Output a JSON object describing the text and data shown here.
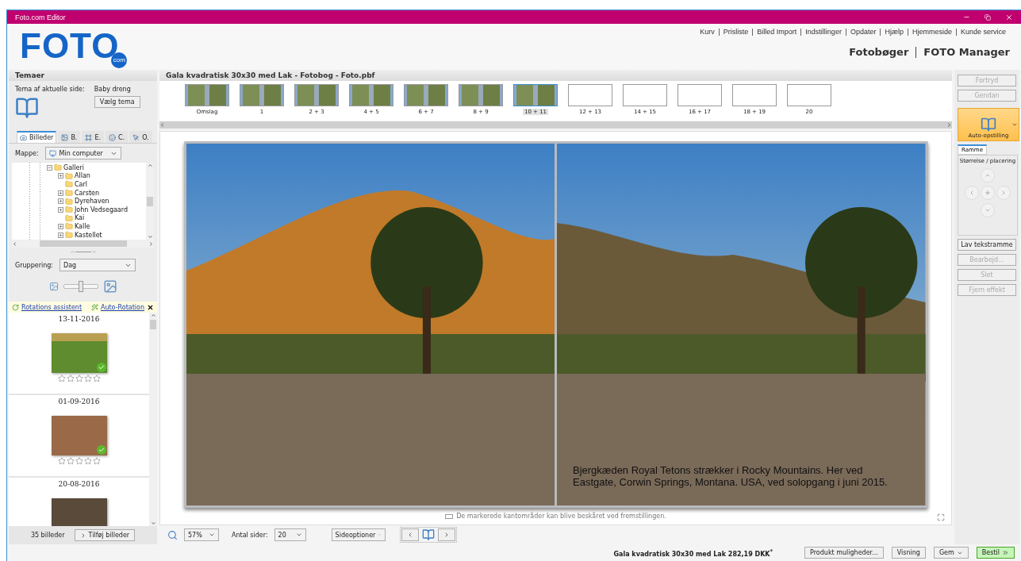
{
  "window": {
    "title": "Foto.com Editor"
  },
  "logo": {
    "text": "FOTO",
    "badge": "com"
  },
  "top_links": [
    "Kurv",
    "Prisliste",
    "Billed Import",
    "Indstillinger",
    "Opdater",
    "Hjælp",
    "Hjemmeside",
    "Kunde service"
  ],
  "header_nav": [
    "Fotobøger",
    "FOTO Manager"
  ],
  "themes": {
    "title": "Temaer",
    "label": "Tema af aktuelle side:",
    "value": "Baby dreng",
    "button": "Vælg tema"
  },
  "source_tabs": [
    {
      "label": "Billeder",
      "selected": true
    },
    {
      "label": "B.",
      "selected": false
    },
    {
      "label": "E.",
      "selected": false
    },
    {
      "label": "C.",
      "selected": false
    },
    {
      "label": "O.",
      "selected": false
    }
  ],
  "folder": {
    "label": "Mappe:",
    "value": "Min computer"
  },
  "tree": [
    {
      "label": "Galleri",
      "kind": "branch",
      "expanded": true,
      "children": [
        {
          "label": "Allan",
          "kind": "branch",
          "expanded": false
        },
        {
          "label": "Carl",
          "kind": "leaf"
        },
        {
          "label": "Carsten",
          "kind": "branch",
          "expanded": false
        },
        {
          "label": "Dyrehaven",
          "kind": "branch",
          "expanded": false
        },
        {
          "label": "John Vedsegaard",
          "kind": "branch",
          "expanded": false
        },
        {
          "label": "Kai",
          "kind": "leaf"
        },
        {
          "label": "Kalle",
          "kind": "branch",
          "expanded": false
        },
        {
          "label": "Kastellet",
          "kind": "branch",
          "expanded": false
        }
      ]
    }
  ],
  "grouping": {
    "label": "Gruppering:",
    "value": "Dag"
  },
  "thumb_size": {
    "level": 0.5
  },
  "rotation": {
    "assistant": "Rotations assistent",
    "auto": "Auto-Rotation"
  },
  "photo_groups": [
    {
      "date": "13-11-2016",
      "photo": {
        "stars": 0,
        "used": true
      }
    },
    {
      "date": "01-09-2016",
      "photo": {
        "stars": 0,
        "used": true
      }
    },
    {
      "date": "20-08-2016"
    }
  ],
  "photo_footer": {
    "count": "35 billeder",
    "button": "Tilføj billeder"
  },
  "document": {
    "title": "Gala kvadratisk 30x30 med Lak - Fotobog - Foto.pbf"
  },
  "pages": [
    {
      "label": "Omslag",
      "kind": "photo",
      "selected": false
    },
    {
      "label": "1",
      "kind": "photo",
      "selected": false
    },
    {
      "label": "2 + 3",
      "kind": "photo",
      "selected": false
    },
    {
      "label": "4 + 5",
      "kind": "photo",
      "selected": false
    },
    {
      "label": "6 + 7",
      "kind": "photo",
      "selected": false
    },
    {
      "label": "8 + 9",
      "kind": "photo",
      "selected": false
    },
    {
      "label": "10 + 11",
      "kind": "photo",
      "selected": true
    },
    {
      "label": "12 + 13",
      "kind": "empty",
      "selected": false
    },
    {
      "label": "14 + 15",
      "kind": "empty",
      "selected": false
    },
    {
      "label": "16 + 17",
      "kind": "empty",
      "selected": false
    },
    {
      "label": "18 + 19",
      "kind": "empty",
      "selected": false
    },
    {
      "label": "20",
      "kind": "empty",
      "selected": false
    }
  ],
  "spread": {
    "caption": "Bjergkæden Royal Tetons strækker i Rocky Mountains. Her ved Eastgate, Corwin Springs, Montana. USA, ved solopgang i juni 2015.",
    "notice": "De markerede kantområder kan blive beskåret ved fremstillingen."
  },
  "toolbar": {
    "zoom": "57%",
    "pages_label": "Antal sider:",
    "pages_value": "20",
    "page_options": "Sideoptioner"
  },
  "side_actions": [
    {
      "label": "Fortryd",
      "disabled": true
    },
    {
      "label": "Gendan",
      "disabled": true
    }
  ],
  "auto_layout": {
    "label": "Auto-opstilling"
  },
  "frame_panel": {
    "tab": "Ramme",
    "title": "Størrelse / placering"
  },
  "frame_actions": [
    {
      "label": "Lav tekstramme",
      "disabled": false
    },
    {
      "label": "Bearbejd...",
      "disabled": true
    },
    {
      "label": "Slet",
      "disabled": true
    },
    {
      "label": "Fjern effekt",
      "disabled": true
    }
  ],
  "status_bar": {
    "price": "Gala kvadratisk 30x30 med Lak 282,19 DKK$^{*}$",
    "buttons": [
      {
        "label": "Produkt muligheder...",
        "kind": "plain"
      },
      {
        "label": "Visning",
        "kind": "plain"
      },
      {
        "label": "Gem",
        "kind": "dropdown"
      },
      {
        "label": "Bestil",
        "kind": "order"
      }
    ]
  }
}
